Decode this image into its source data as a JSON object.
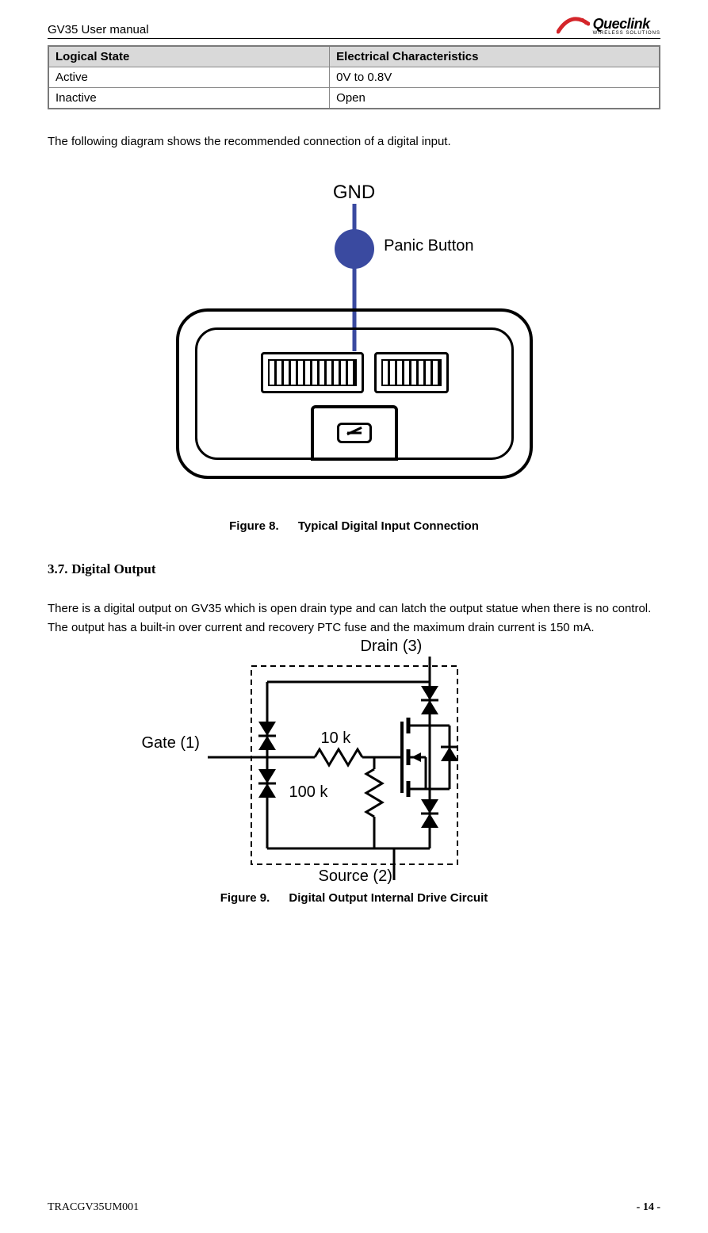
{
  "header": {
    "doc_title": "GV35 User manual",
    "logo_brand": "Queclink",
    "logo_tagline": "WIRELESS SOLUTIONS"
  },
  "table": {
    "col1": "Logical State",
    "col2": "Electrical Characteristics",
    "rows": [
      {
        "state": "Active",
        "char": "0V to 0.8V"
      },
      {
        "state": "Inactive",
        "char": "Open"
      }
    ]
  },
  "intro_para": "The following diagram shows the recommended connection of a digital input.",
  "fig8": {
    "gnd": "GND",
    "panic": "Panic Button",
    "caption_num": "Figure 8.",
    "caption_title": "Typical Digital Input Connection"
  },
  "section": {
    "number": "3.7.",
    "title": "Digital Output"
  },
  "section_para": "There is a digital output on GV35 which is open drain type and can latch the output statue when there is no control. The output has a built-in over current and recovery PTC fuse and the maximum drain current is 150 mA.",
  "fig9": {
    "gate": "Gate (1)",
    "source": "Source (2)",
    "drain": "Drain (3)",
    "r1": "10 k",
    "r2": "100 k",
    "caption_num": "Figure 9.",
    "caption_title": "Digital Output Internal Drive Circuit"
  },
  "footer": {
    "left": "TRACGV35UM001",
    "right": "- 14 -"
  }
}
